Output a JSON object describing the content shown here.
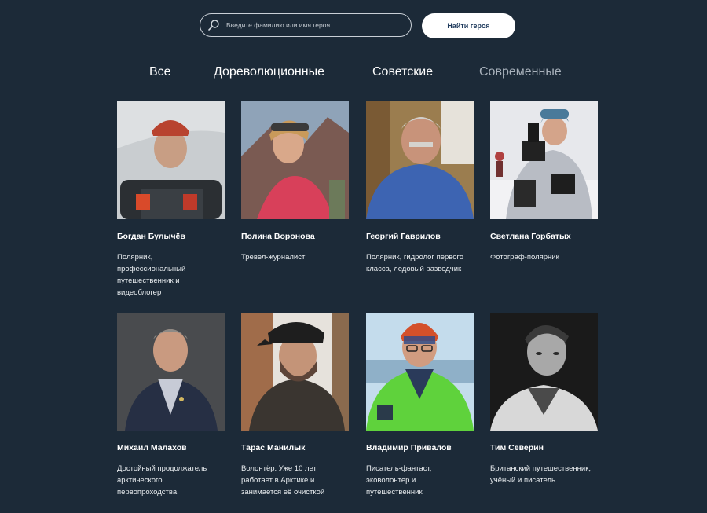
{
  "search": {
    "placeholder": "Введите фамилию или имя героя",
    "button_label": "Найти героя"
  },
  "tabs": [
    {
      "label": "Все"
    },
    {
      "label": "Дореволюционные"
    },
    {
      "label": "Советские"
    },
    {
      "label": "Современные"
    }
  ],
  "heroes": [
    {
      "name": "Богдан Булычёв",
      "description": "Полярник, профессиональный путешественник и видеоблогер"
    },
    {
      "name": "Полина Воронова",
      "description": "Тревел-журналист"
    },
    {
      "name": "Георгий Гаврилов",
      "description": "Полярник, гидролог первого класса, ледовый разведчик"
    },
    {
      "name": "Светлана Горбатых",
      "description": "Фотограф-полярник"
    },
    {
      "name": "Михаил Малахов",
      "description": "Достойный продолжатель арктического первопроходства"
    },
    {
      "name": "Тарас Манилык",
      "description": "Волонтёр. Уже 10 лет работает в Арктике и занимается её очисткой"
    },
    {
      "name": "Владимир Привалов",
      "description": "Писатель-фантаст, эковолонтер и путешественник"
    },
    {
      "name": "Тим Северин",
      "description": "Британский путешественник, учёный и писатель"
    }
  ],
  "colors": {
    "background": "#1c2a38",
    "button_text": "#1e3a5c",
    "muted_tab": "#a9b2bc"
  }
}
